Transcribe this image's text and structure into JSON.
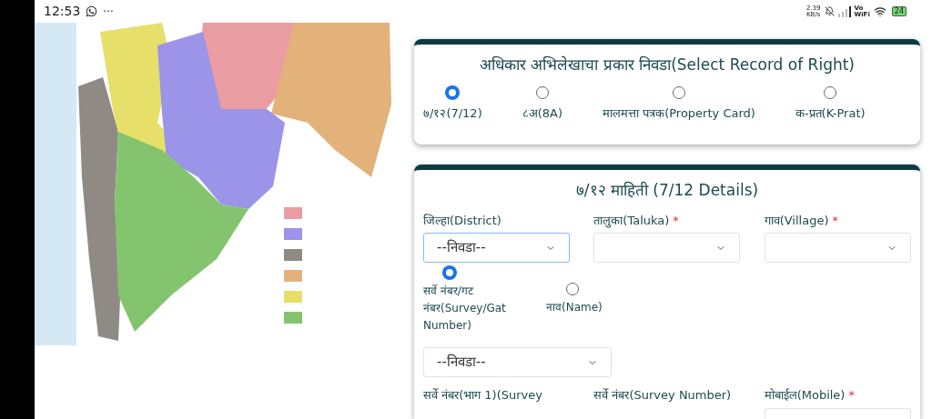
{
  "status_bar": {
    "time": "12:53",
    "more": "···",
    "net_speed": [
      "2.39",
      "KB/s"
    ],
    "wifi_label": [
      "Vo",
      "WiFi"
    ],
    "battery": "24"
  },
  "record_type_card": {
    "title": "अधिकार अभिलेखाचा प्रकार निवडा(Select Record of Right)",
    "options": [
      {
        "label": "७/१२(7/12)",
        "selected": true
      },
      {
        "label": "८अ(8A)",
        "selected": false
      },
      {
        "label": "मालमत्ता पत्रक(Property Card)",
        "selected": false
      },
      {
        "label": "क-प्रत(K-Prat)",
        "selected": false
      }
    ]
  },
  "details_card": {
    "title": "७/१२ माहिती (7/12 Details)",
    "required_mark": "*",
    "fields": [
      {
        "label": "जिल्हा(District)",
        "required": false,
        "value": "--निवडा--",
        "focused": true
      },
      {
        "label": "तालुका(Taluka)",
        "required": true,
        "focused": false
      },
      {
        "label": "गाव(Village)",
        "required": true,
        "focused": false
      }
    ],
    "search_by": [
      {
        "label": "सर्वे नंबर/गट नंबर(Survey/Gat Number)",
        "selected": true
      },
      {
        "label": "नाव(Name)",
        "selected": false
      }
    ],
    "search_select": {
      "value": "--निवडा--"
    },
    "bottom_fields": [
      {
        "label": "सर्वे नंबर(भाग 1)(Survey",
        "required": false,
        "field": false
      },
      {
        "label": "सर्वे नंबर(Survey Number)",
        "required": false,
        "field": false
      },
      {
        "label": "मोबाईल(Mobile)",
        "required": true,
        "field": true
      }
    ]
  }
}
